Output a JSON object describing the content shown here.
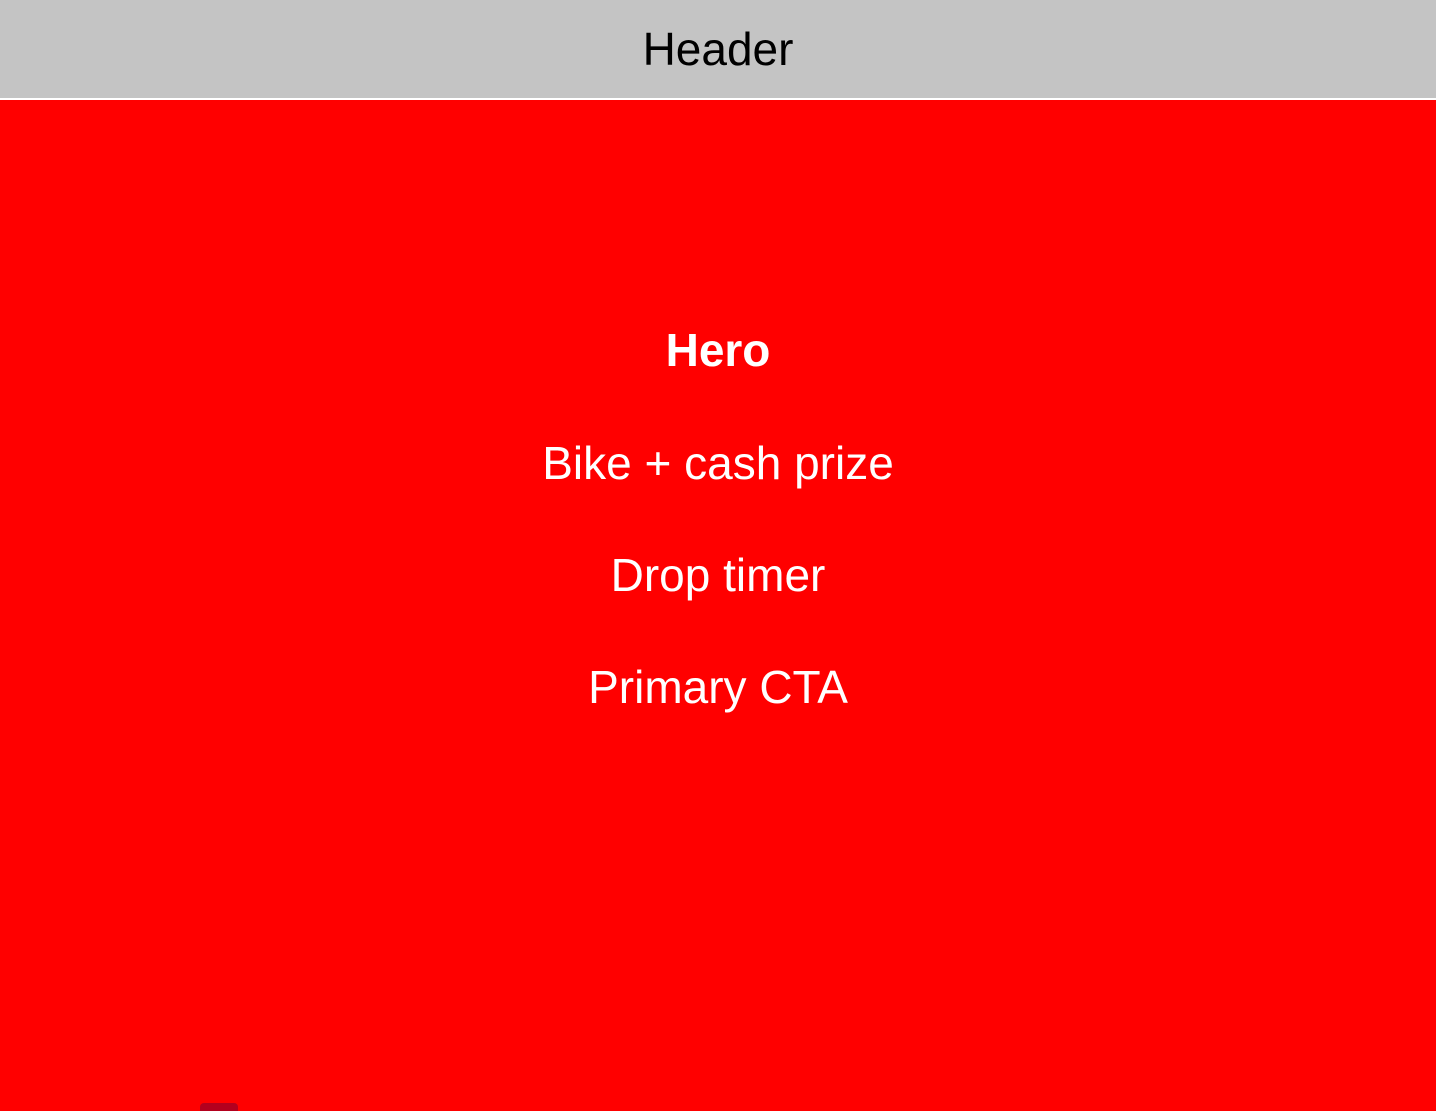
{
  "header": {
    "title": "Header"
  },
  "hero": {
    "title": "Hero",
    "items": [
      "Bike + cash prize",
      "Drop timer",
      "Primary CTA"
    ]
  },
  "colors": {
    "header_bg": "#c4c4c4",
    "hero_bg": "#ff0000",
    "hero_text": "#ffffff"
  }
}
